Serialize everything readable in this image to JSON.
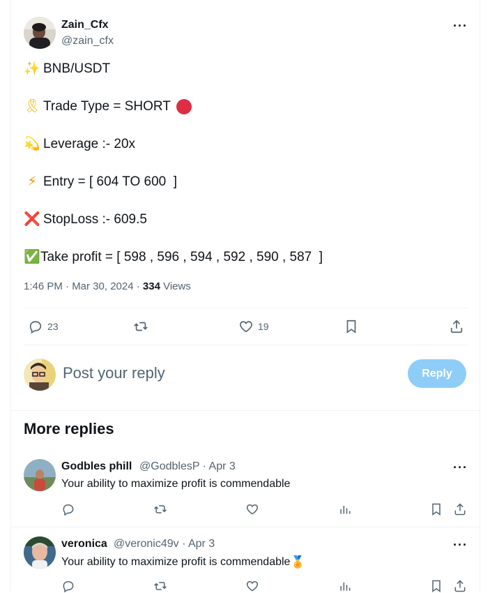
{
  "post": {
    "author_name": "Zain_Cfx",
    "author_handle": "@zain_cfx",
    "more_label": "···",
    "lines": [
      {
        "emoji": "✨",
        "text": "BNB/USDT"
      },
      {
        "emoji": "🎗",
        "text": "Trade Type = SHORT"
      },
      {
        "emoji": "💫",
        "text": "Leverage :- 20x"
      },
      {
        "emoji": "⚡",
        "text": "Entry = [ 604 TO 600  ]"
      },
      {
        "emoji": "❌",
        "text": "StopLoss :- 609.5"
      },
      {
        "emoji": "✅",
        "text": "Take profit = [ 598 , 596 , 594 , 592 , 590 , 587  ]"
      }
    ],
    "time": "1:46 PM · Mar 30, 2024 · ",
    "views_count": "334",
    "views_label": " Views",
    "actions": {
      "replies": "23",
      "likes": "19"
    }
  },
  "composer": {
    "placeholder": "Post your reply",
    "button": "Reply"
  },
  "more_replies": {
    "title": "More replies",
    "items": [
      {
        "name": "Godbles phill",
        "meta": "@GodblesP · Apr 3",
        "text": "Your ability to maximize profit is commendable",
        "emoji": ""
      },
      {
        "name": "veronica",
        "meta": "@veronic49v · Apr 3",
        "text": "Your ability to maximize profit is commendable",
        "emoji": "🏅"
      }
    ]
  },
  "colors": {
    "accent": "#1d9bf0",
    "reply_button": "#8ecdf8",
    "secondary_text": "#536471",
    "divider": "#eff3f4",
    "short_dot": "#dd2e44"
  }
}
